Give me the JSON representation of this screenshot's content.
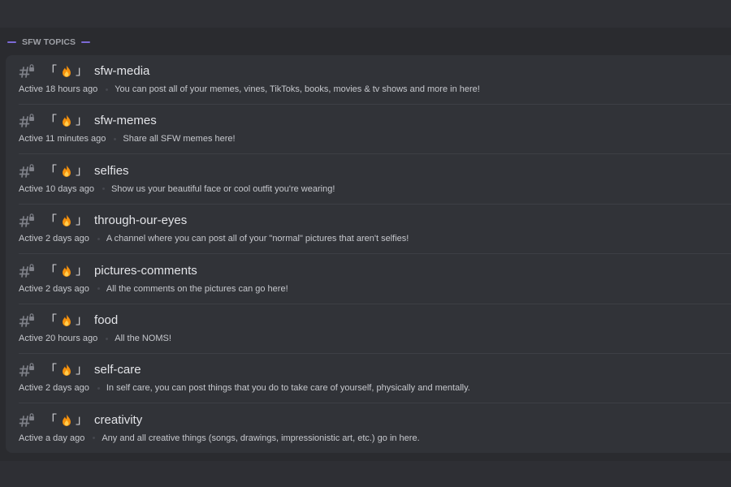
{
  "category": {
    "title": "SFW TOPICS",
    "accent_color": "#7c6ad6"
  },
  "channel_prefix": {
    "open_bracket": "「",
    "icon": "fire-emoji",
    "close_bracket": "」"
  },
  "channels": [
    {
      "name": "sfw-media",
      "activity": "Active 18 hours ago",
      "description": "You can post all of your memes, vines, TikToks, books, movies & tv shows and more in here!"
    },
    {
      "name": "sfw-memes",
      "activity": "Active 11 minutes ago",
      "description": "Share all SFW memes here!"
    },
    {
      "name": "selfies",
      "activity": "Active 10 days ago",
      "description": "Show us your beautiful face or cool outfit you're wearing!"
    },
    {
      "name": "through-our-eyes",
      "activity": "Active 2 days ago",
      "description": "A channel where you can post all of your \"normal\" pictures that aren't selfies!"
    },
    {
      "name": "pictures-comments",
      "activity": "Active 2 days ago",
      "description": "All the comments on the pictures can go here!"
    },
    {
      "name": "food",
      "activity": "Active 20 hours ago",
      "description": "All the NOMS!"
    },
    {
      "name": "self-care",
      "activity": "Active 2 days ago",
      "description": "In self care, you can post things that you do to take care of yourself, physically and mentally."
    },
    {
      "name": "creativity",
      "activity": "Active a day ago",
      "description": "Any and all creative things (songs, drawings, impressionistic art, etc.) go in here."
    }
  ]
}
